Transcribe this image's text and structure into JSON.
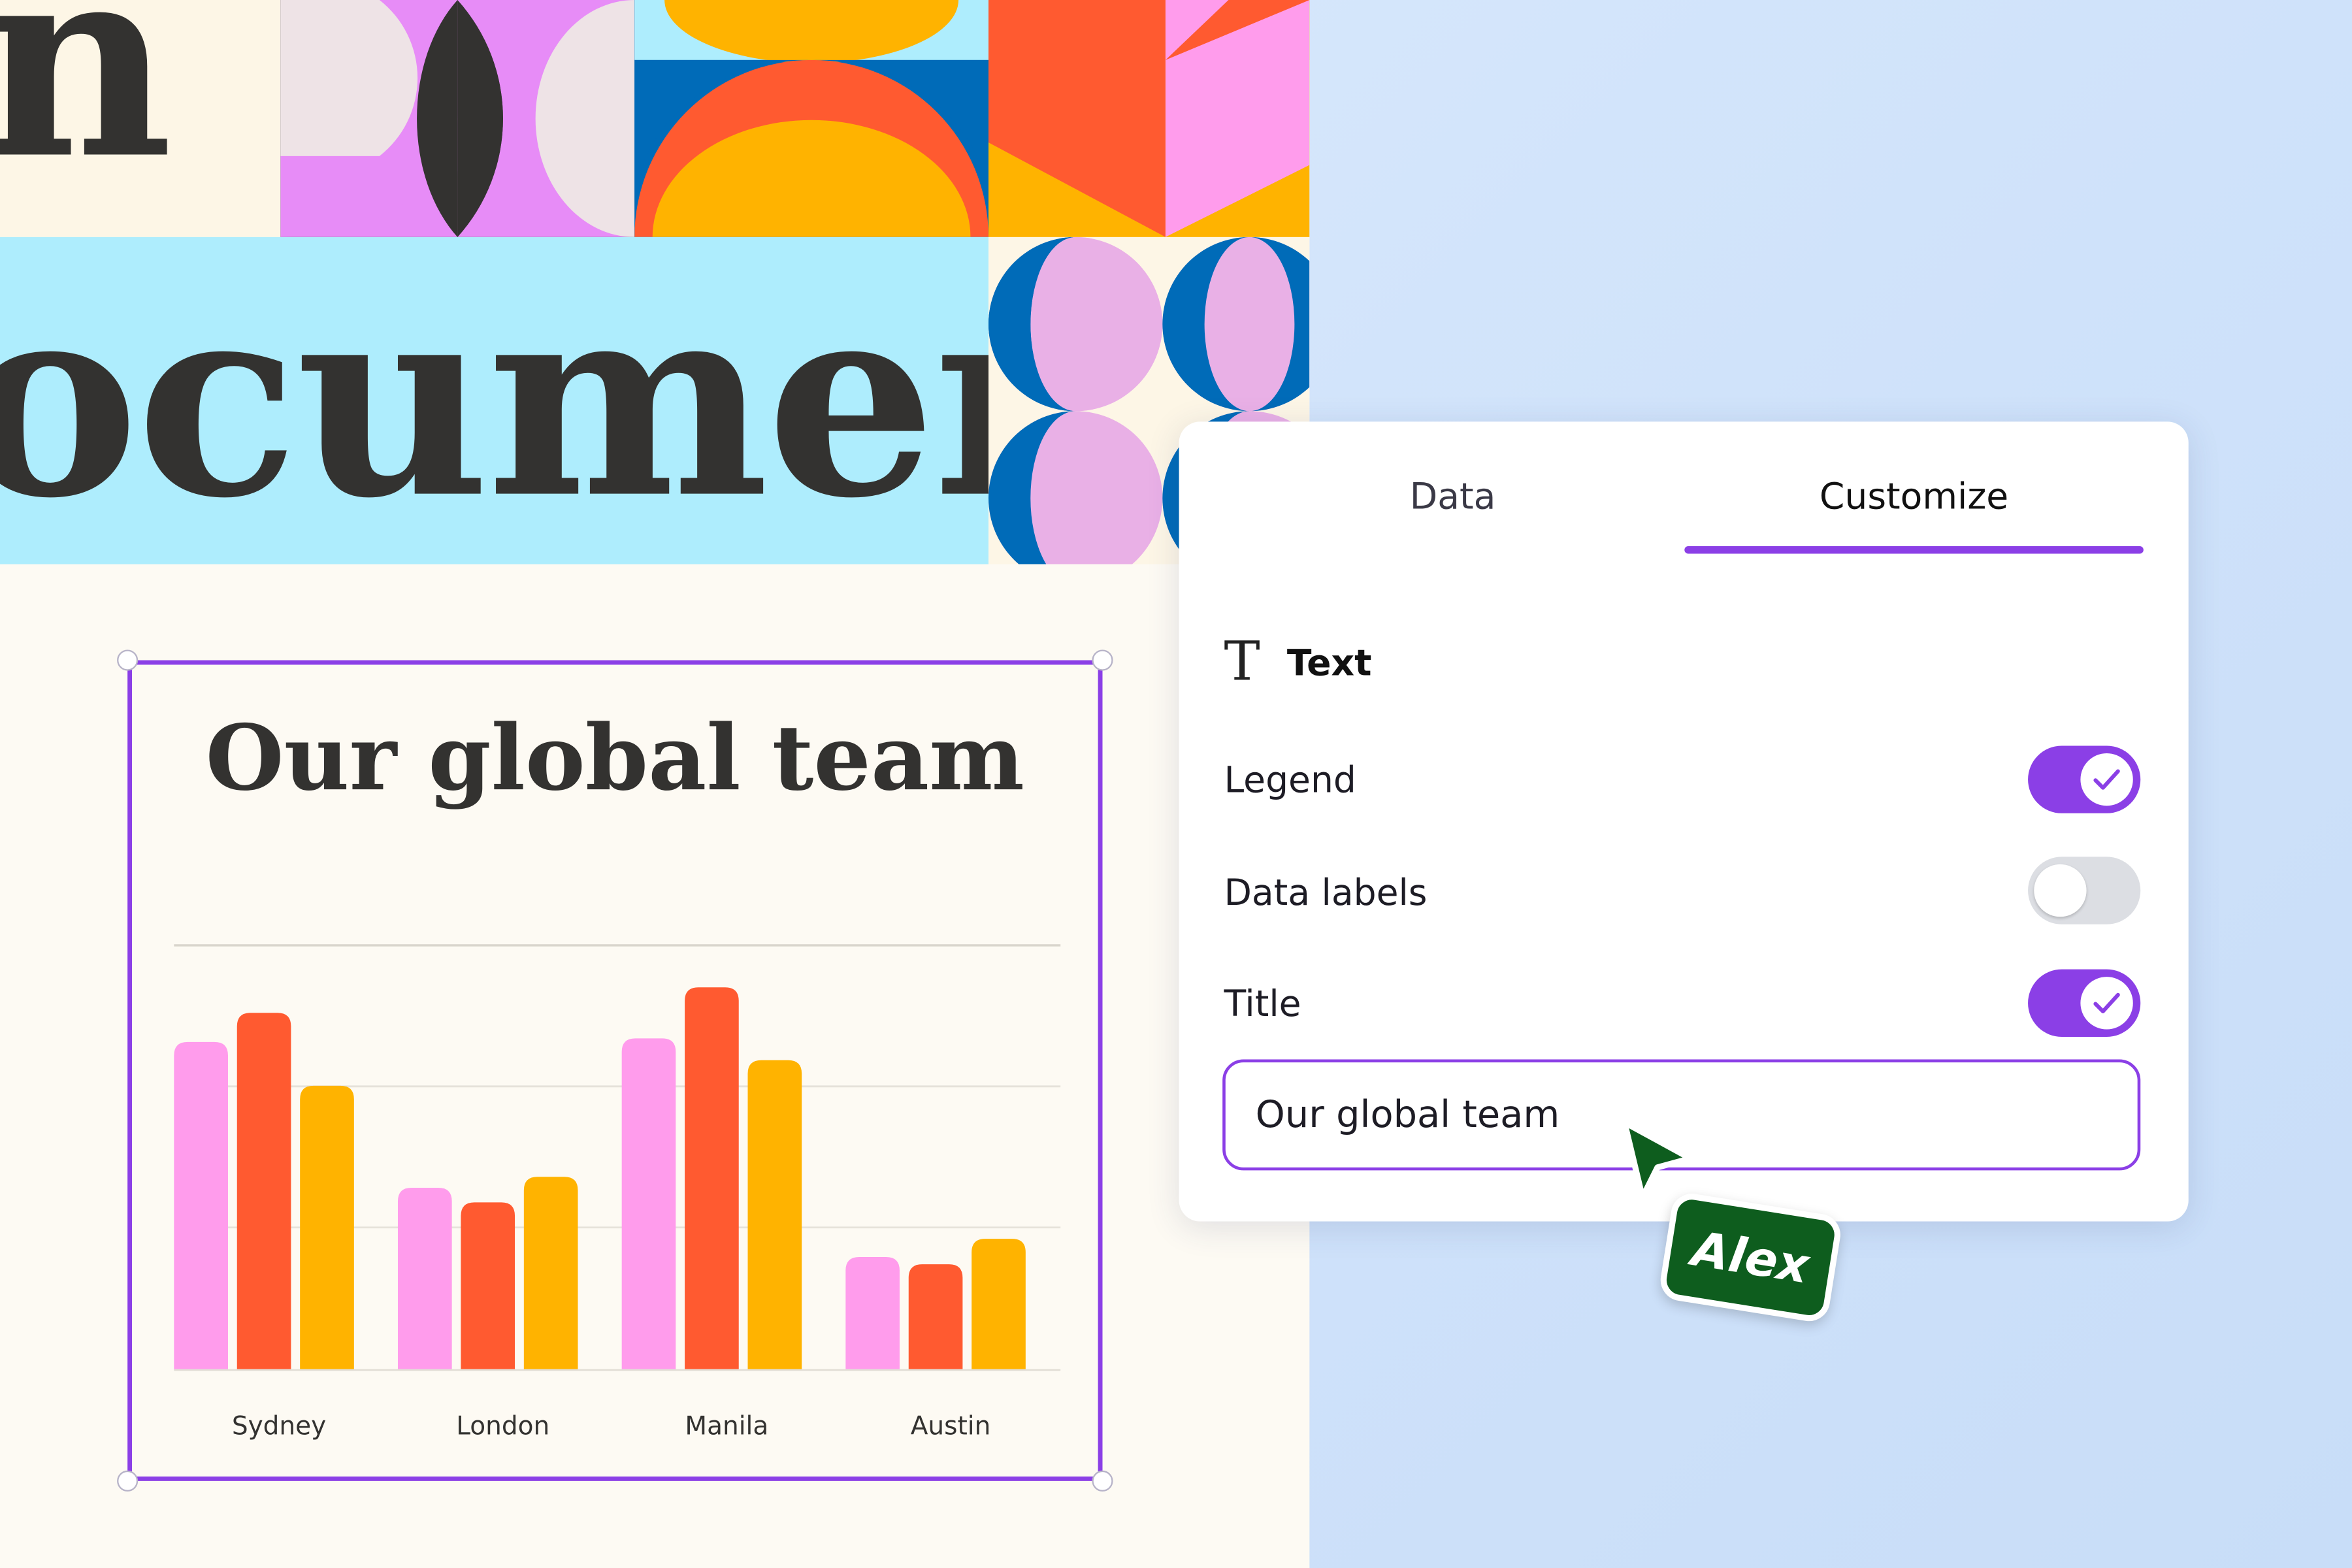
{
  "document": {
    "heading_line1": "n",
    "heading_line2": "ocument"
  },
  "chart_data": {
    "type": "bar",
    "title": "Our global team",
    "categories": [
      "Sydney",
      "London",
      "Manila",
      "Austin"
    ],
    "series": [
      {
        "values": [
          9.0,
          5.0,
          9.1,
          3.1
        ],
        "color": "#ff9cec"
      },
      {
        "values": [
          9.8,
          4.6,
          10.5,
          2.9
        ],
        "color": "#ff5a30"
      },
      {
        "values": [
          7.8,
          5.3,
          8.5,
          3.6
        ],
        "color": "#ffb300"
      }
    ],
    "ylim": [
      0,
      10.5
    ],
    "grid": true
  },
  "panel": {
    "tabs": [
      {
        "label": "Data",
        "active": false
      },
      {
        "label": "Customize",
        "active": true
      }
    ],
    "section_label": "Text",
    "section_icon": "text-icon",
    "options": [
      {
        "label": "Legend",
        "enabled": true
      },
      {
        "label": "Data labels",
        "enabled": false
      },
      {
        "label": "Title",
        "enabled": true
      }
    ],
    "title_input_value": "Our global team"
  },
  "collaborator": {
    "name": "Alex",
    "color": "#0e5d1e"
  },
  "colors": {
    "accent": "#8b3fe6",
    "pink": "#ff9cec",
    "orange": "#ff5a30",
    "yellow": "#ffb300",
    "blue": "#006bb8",
    "lilac": "#e78cf7",
    "sky": "#aeedfd"
  }
}
